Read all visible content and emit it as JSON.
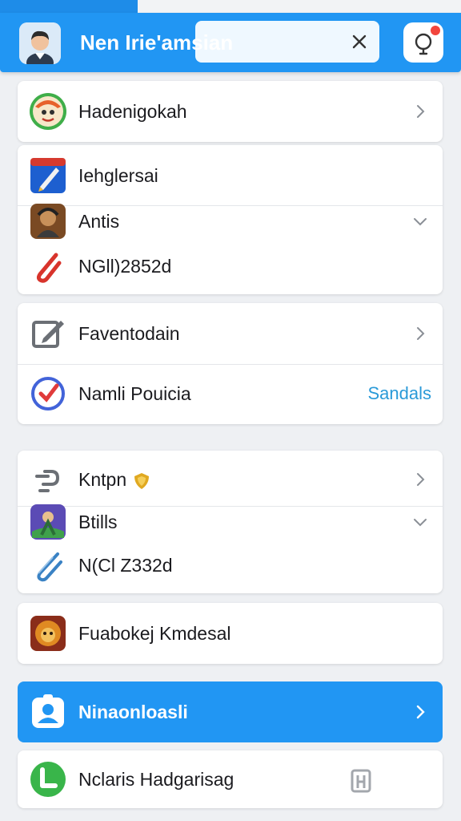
{
  "header": {
    "title": "Nen Irie'amsian",
    "search": {
      "placeholder": ""
    },
    "colors": {
      "header_bg": "#2196f3",
      "notif_dot": "#f2453d"
    },
    "icons": {
      "avatar": "user-avatar",
      "clear": "close-icon",
      "notification": "notification-icon"
    }
  },
  "cards": {
    "c1": {
      "r1": {
        "label": "Hadenigokah",
        "icon": "app-icon-cartoon"
      }
    },
    "c2": {
      "r1": {
        "label": "Iehglersai",
        "icon": "app-icon-pen"
      },
      "r2": {
        "label": "Antis",
        "icon": "app-icon-warrior"
      },
      "r3": {
        "label": "NGll)2852d",
        "icon": "paperclip-icon"
      }
    },
    "c3": {
      "r1": {
        "label": "Faventodain",
        "icon": "edit-icon"
      },
      "r2": {
        "label": "Namli Pouicia",
        "icon": "check-circle-icon",
        "action": "Sandals"
      }
    },
    "c4": {
      "r1": {
        "label": "Kntpn",
        "icon": "link-icon",
        "badge": "shield-badge-icon"
      },
      "r2": {
        "label": "Btills",
        "icon": "app-icon-game"
      },
      "r3": {
        "label": "N(Cl Z332d",
        "icon": "paperclip-icon"
      }
    },
    "c5": {
      "r1": {
        "label": "Fuabokej Kmdesal",
        "icon": "app-icon-lion"
      }
    },
    "c6": {
      "r1": {
        "label": "Ninaonloasli",
        "icon": "contacts-icon"
      }
    },
    "c7": {
      "r1": {
        "label": "Nclaris Hadgarisag",
        "icon": "phone-app-icon",
        "trailing": "building-icon"
      }
    }
  },
  "colors": {
    "accent": "#2196f3",
    "link": "#2a9ad8",
    "background": "#eef0f3"
  }
}
